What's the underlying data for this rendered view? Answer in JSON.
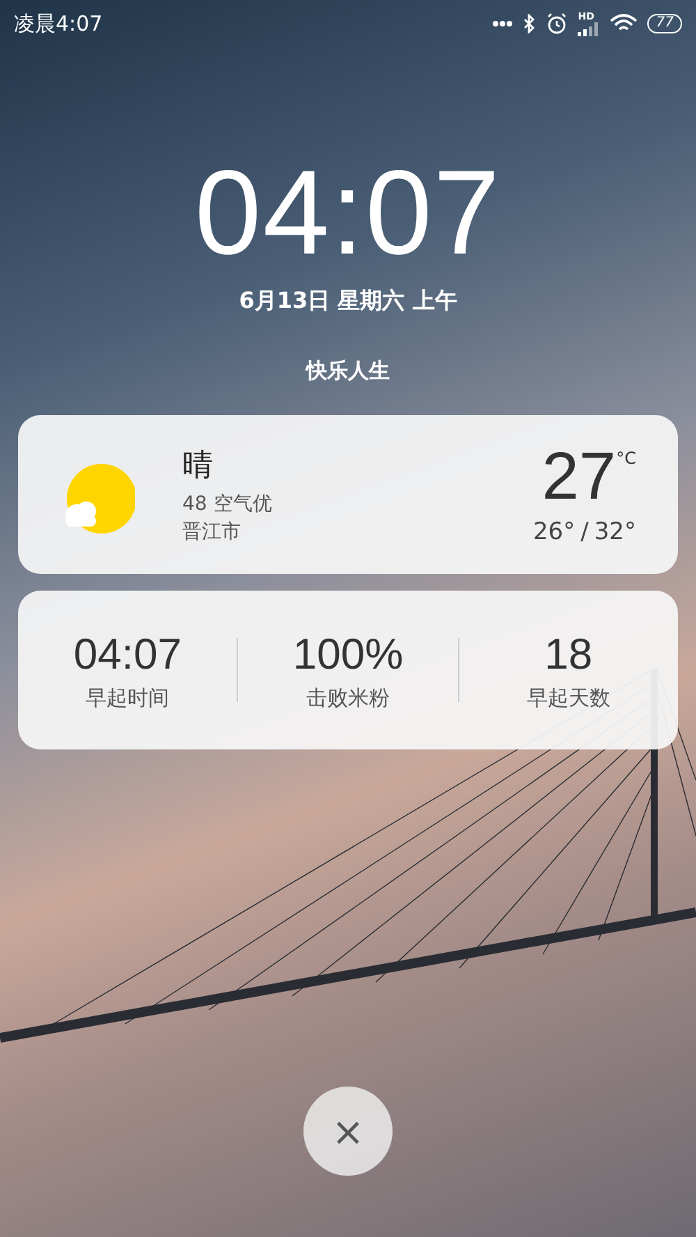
{
  "status_bar": {
    "time": "凌晨4:07",
    "signal_label": "HD",
    "battery": "77"
  },
  "clock": {
    "time": "04:07",
    "date": "6月13日 星期六 上午"
  },
  "motto": "快乐人生",
  "weather": {
    "condition": "晴",
    "air_quality": "48 空气优",
    "city": "晋江市",
    "temperature": "27",
    "unit": "°C",
    "low": "26°",
    "separator": "/",
    "high": "32°"
  },
  "stats": [
    {
      "value": "04:07",
      "label": "早起时间"
    },
    {
      "value": "100%",
      "label": "击败米粉"
    },
    {
      "value": "18",
      "label": "早起天数"
    }
  ],
  "close_button": "×"
}
